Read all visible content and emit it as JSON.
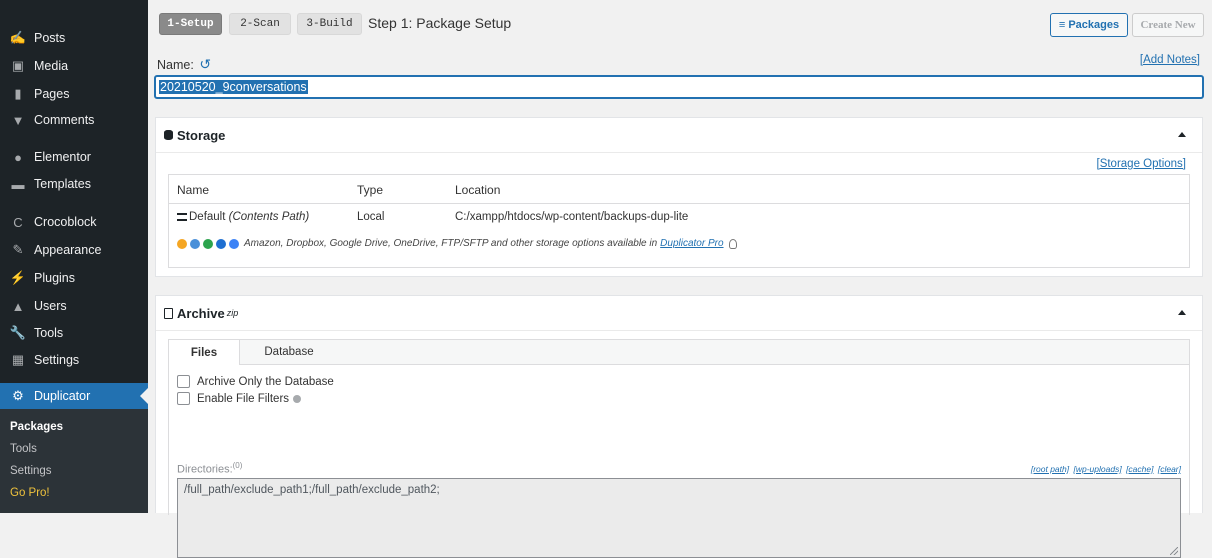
{
  "sidebar": {
    "items": [
      {
        "label": "Posts",
        "icon": "pin-icon",
        "glyph": "✍"
      },
      {
        "label": "Media",
        "icon": "media-icon",
        "glyph": "▣"
      },
      {
        "label": "Pages",
        "icon": "pages-icon",
        "glyph": "▮"
      },
      {
        "label": "Comments",
        "icon": "comments-icon",
        "glyph": "▼"
      },
      {
        "label": "Elementor",
        "icon": "elementor-icon",
        "glyph": "●"
      },
      {
        "label": "Templates",
        "icon": "folder-icon",
        "glyph": "▬"
      },
      {
        "label": "Crocoblock",
        "icon": "crocoblock-icon",
        "glyph": "C"
      },
      {
        "label": "Appearance",
        "icon": "brush-icon",
        "glyph": "✎"
      },
      {
        "label": "Plugins",
        "icon": "plug-icon",
        "glyph": "⚡"
      },
      {
        "label": "Users",
        "icon": "user-icon",
        "glyph": "▲"
      },
      {
        "label": "Tools",
        "icon": "wrench-icon",
        "glyph": "🔧"
      },
      {
        "label": "Settings",
        "icon": "settings-icon",
        "glyph": "▦"
      },
      {
        "label": "Duplicator",
        "icon": "gear-icon",
        "glyph": "⚙"
      }
    ],
    "submenu": {
      "packages": "Packages",
      "tools": "Tools",
      "settings": "Settings",
      "gopro": "Go Pro!"
    }
  },
  "header": {
    "steps": [
      "1-Setup",
      "2-Scan",
      "3-Build"
    ],
    "title": "Step 1: Package Setup",
    "packages_btn": "Packages",
    "packages_icon": "≡",
    "create_new_btn": "Create New"
  },
  "name_section": {
    "label": "Name:",
    "undo_icon": "↺",
    "add_notes": "[Add Notes]",
    "value": "20210520_9conversations"
  },
  "storage": {
    "title": "Storage",
    "icon": "database-icon",
    "options_link": "[Storage Options]",
    "columns": [
      "Name",
      "Type",
      "Location"
    ],
    "row": {
      "name": "Default",
      "name_note": "(Contents Path)",
      "type": "Local",
      "location": "C:/xampp/htdocs/wp-content/backups-dup-lite"
    },
    "cloud_text": "Amazon, Dropbox, Google Drive, OneDrive, FTP/SFTP and other storage options available in",
    "cloud_link": "Duplicator Pro",
    "cloud_colors": [
      "#f5a623",
      "#4a90d9",
      "#2da44e",
      "#1f6fd1",
      "#3b82f6"
    ]
  },
  "archive": {
    "title": "Archive",
    "suffix": "zip",
    "tabs": [
      "Files",
      "Database"
    ],
    "db_only_label": "Archive Only the Database",
    "file_filters_label": "Enable File Filters",
    "directories_label": "Directories:",
    "directories_count": "(0)",
    "links": [
      "[root path]",
      "[wp-uploads]",
      "[cache]",
      "[clear]"
    ],
    "directories_value": "/full_path/exclude_path1;/full_path/exclude_path2;"
  }
}
